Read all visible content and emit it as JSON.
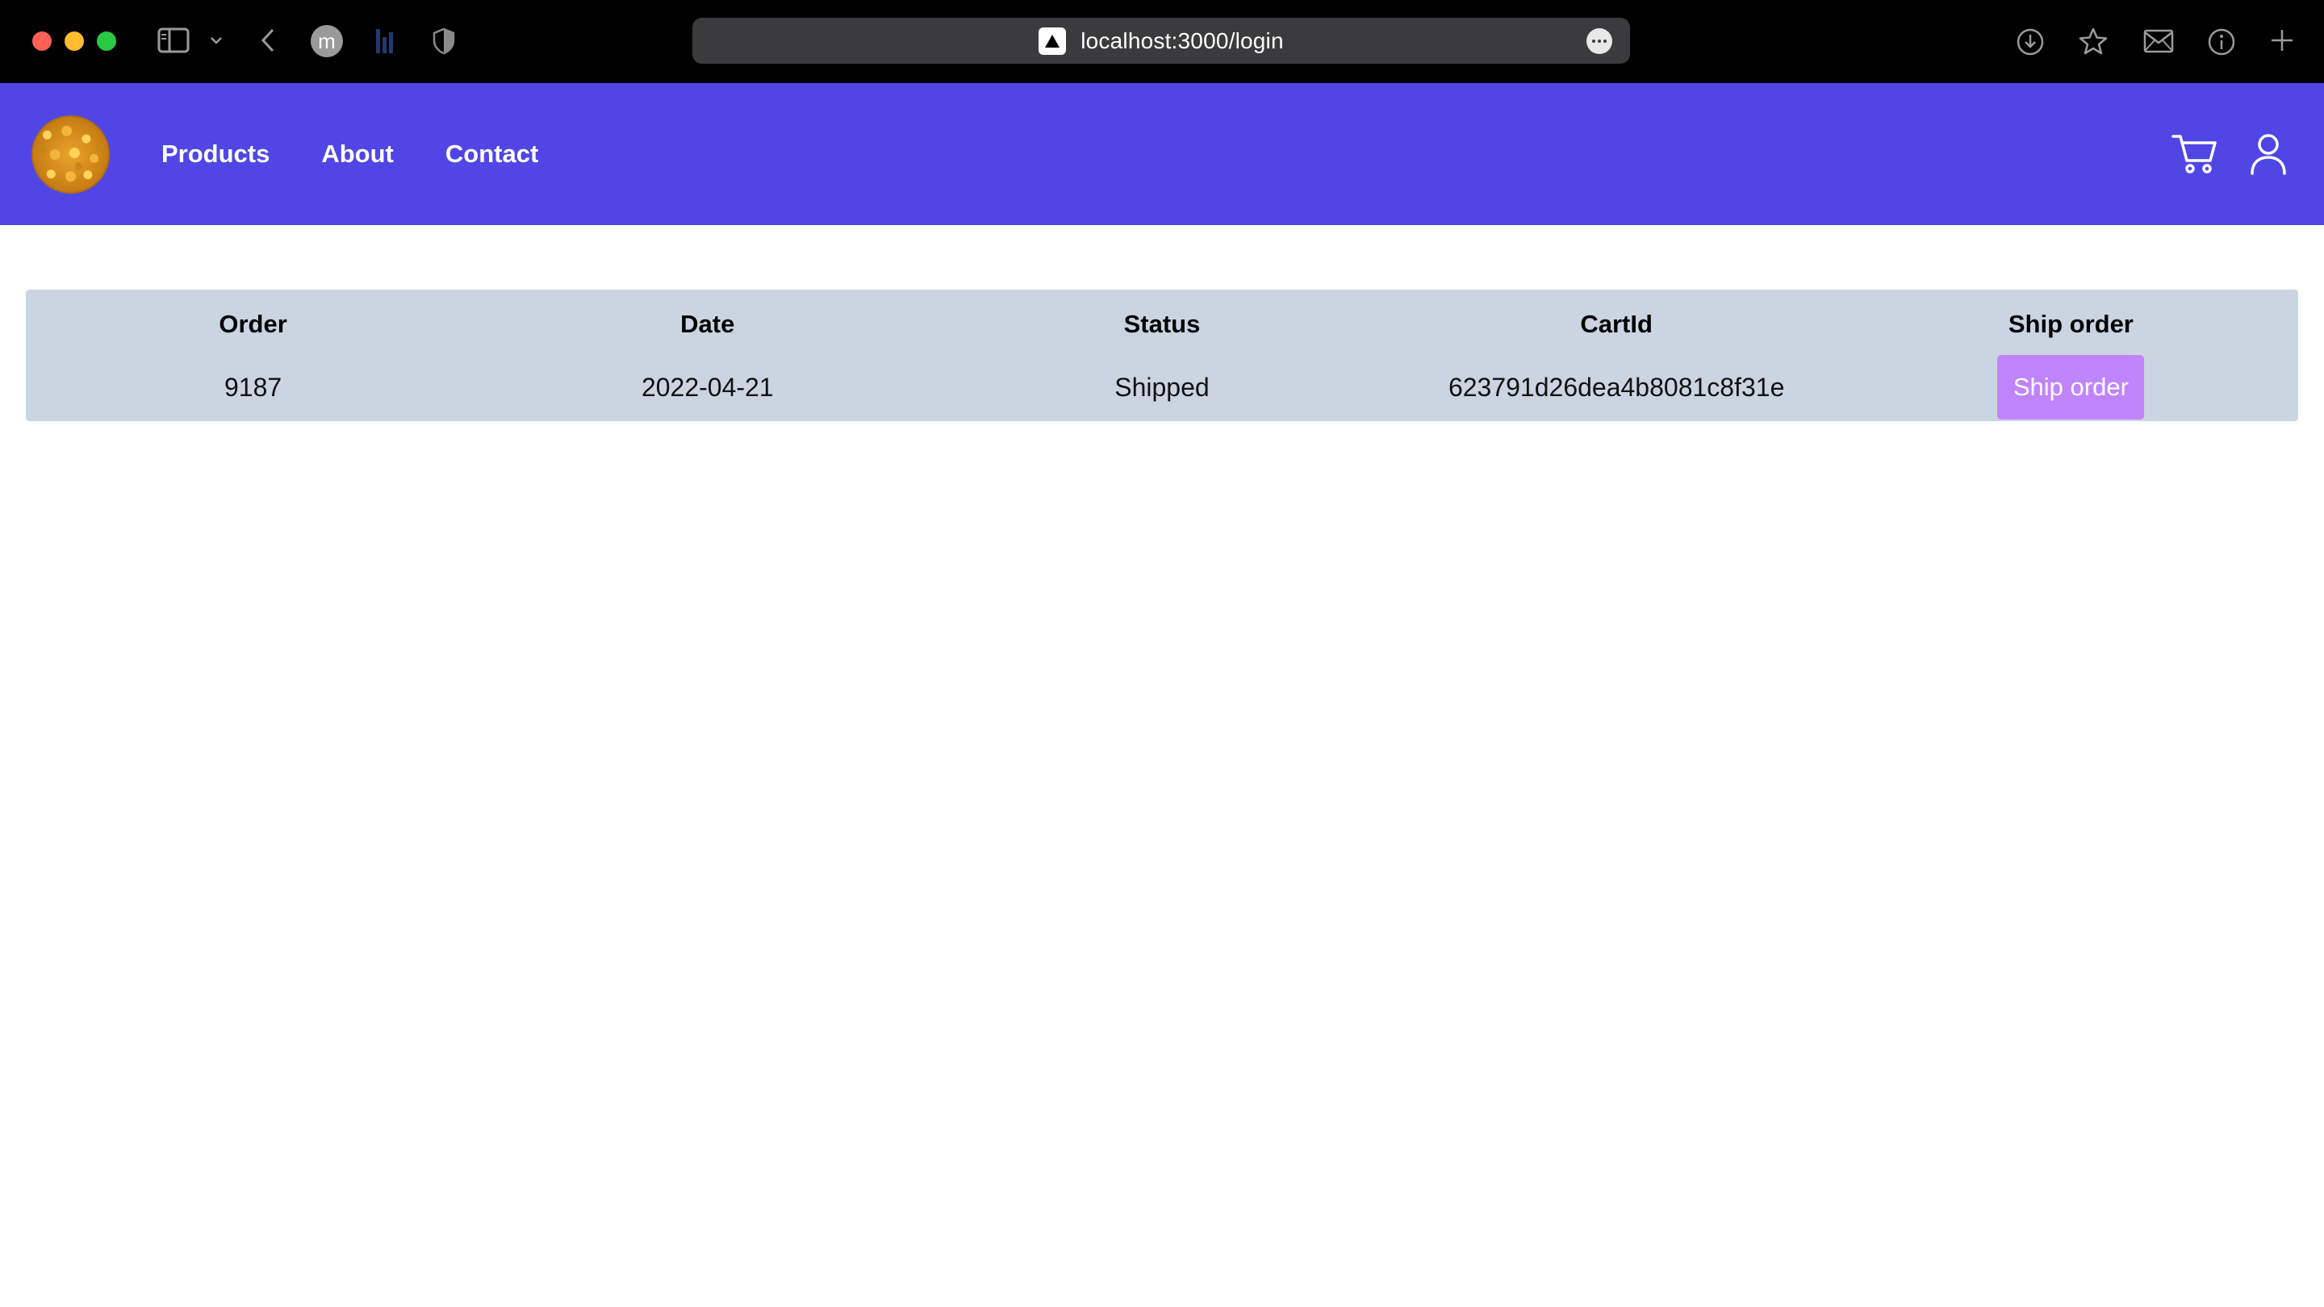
{
  "browser": {
    "url": "localhost:3000/login",
    "profile_initial": "m"
  },
  "nav": {
    "links": [
      "Products",
      "About",
      "Contact"
    ]
  },
  "orders_table": {
    "headers": [
      "Order",
      "Date",
      "Status",
      "CartId",
      "Ship order"
    ],
    "rows": [
      {
        "order": "9187",
        "date": "2022-04-21",
        "status": "Shipped",
        "cart_id": "623791d26dea4b8081c8f31e",
        "action_label": "Ship order"
      }
    ]
  },
  "colors": {
    "nav_background": "#4f46e5",
    "table_background": "#cbd5e1",
    "ship_button": "#c084fc",
    "chrome_background": "#000000"
  }
}
